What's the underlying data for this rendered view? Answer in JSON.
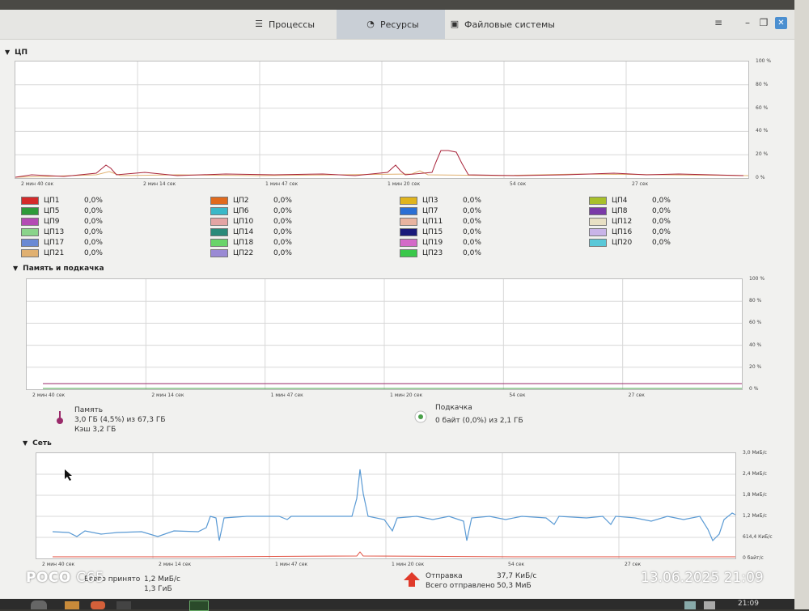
{
  "tabs": [
    {
      "label": "Процессы",
      "icon": "processes-icon"
    },
    {
      "label": "Ресурсы",
      "icon": "resources-icon"
    },
    {
      "label": "Файловые системы",
      "icon": "filesystems-icon"
    }
  ],
  "cpu": {
    "title": "ЦП",
    "y_labels": [
      "100 %",
      "80 %",
      "60 %",
      "40 %",
      "20 %",
      "0 %"
    ],
    "x_labels": [
      "2 мин 40 сек",
      "2 мин 14 сек",
      "1 мин 47 сек",
      "1 мин 20 сек",
      "54 сек",
      "27 сек"
    ],
    "cores": [
      {
        "name": "ЦП1",
        "value": "0,0%",
        "color": "#d42a2a"
      },
      {
        "name": "ЦП2",
        "value": "0,0%",
        "color": "#e06a1d"
      },
      {
        "name": "ЦП3",
        "value": "0,0%",
        "color": "#e0b41d"
      },
      {
        "name": "ЦП4",
        "value": "0,0%",
        "color": "#a8c02b"
      },
      {
        "name": "ЦП5",
        "value": "0,0%",
        "color": "#2e9a3a"
      },
      {
        "name": "ЦП6",
        "value": "0,0%",
        "color": "#3ab8c8"
      },
      {
        "name": "ЦП7",
        "value": "0,0%",
        "color": "#2a6fd4"
      },
      {
        "name": "ЦП8",
        "value": "0,0%",
        "color": "#7a3aa8"
      },
      {
        "name": "ЦП9",
        "value": "0,0%",
        "color": "#b44ab4"
      },
      {
        "name": "ЦП10",
        "value": "0,0%",
        "color": "#e4a4a4"
      },
      {
        "name": "ЦП11",
        "value": "0,0%",
        "color": "#e8b4a0"
      },
      {
        "name": "ЦП12",
        "value": "0,0%",
        "color": "#e8e0c4"
      },
      {
        "name": "ЦП13",
        "value": "0,0%",
        "color": "#8ad48a"
      },
      {
        "name": "ЦП14",
        "value": "0,0%",
        "color": "#2a8a7a"
      },
      {
        "name": "ЦП15",
        "value": "0,0%",
        "color": "#1a1a7a"
      },
      {
        "name": "ЦП16",
        "value": "0,0%",
        "color": "#c8b4e8"
      },
      {
        "name": "ЦП17",
        "value": "0,0%",
        "color": "#6a8ad4"
      },
      {
        "name": "ЦП18",
        "value": "0,0%",
        "color": "#6ad46a"
      },
      {
        "name": "ЦП19",
        "value": "0,0%",
        "color": "#d46ac8"
      },
      {
        "name": "ЦП20",
        "value": "0,0%",
        "color": "#5ac8d8"
      },
      {
        "name": "ЦП21",
        "value": "0,0%",
        "color": "#e0b070"
      },
      {
        "name": "ЦП22",
        "value": "0,0%",
        "color": "#9a8ad4"
      },
      {
        "name": "ЦП23",
        "value": "0,0%",
        "color": "#3ac84a"
      }
    ]
  },
  "memory": {
    "title": "Память и подкачка",
    "y_labels": [
      "100 %",
      "80 %",
      "60 %",
      "40 %",
      "20 %",
      "0 %"
    ],
    "x_labels": [
      "2 мин 40 сек",
      "2 мин 14 сек",
      "1 мин 47 сек",
      "1 мин 20 сек",
      "54 сек",
      "27 сек"
    ],
    "mem_label": "Память",
    "mem_used": "3,0 ГБ (4,5%) из 67,3 ГБ",
    "mem_cache": "Кэш 3,2 ГБ",
    "swap_label": "Подкачка",
    "swap_used": "0 байт (0,0%) из 2,1 ГБ",
    "mem_color": "#9a2a6a",
    "swap_color": "#4aa04a"
  },
  "network": {
    "title": "Сеть",
    "y_labels": [
      "3,0 МиБ/с",
      "2,4 МиБ/с",
      "1,8 МиБ/с",
      "1,2 МиБ/с",
      "614,4 КиБ/с",
      "0 байт/с"
    ],
    "x_labels": [
      "2 мин 40 сек",
      "2 мин 14 сек",
      "1 мин 47 сек",
      "1 мин 20 сек",
      "54 сек",
      "27 сек"
    ],
    "recv_label": "Всего принято",
    "recv_rate": "1,2 МиБ/с",
    "recv_total": "1,3 ГиБ",
    "send_label": "Отправка",
    "send_total_label": "Всего отправлено",
    "send_rate": "37,7 КиБ/с",
    "send_total": "50,3 МиБ",
    "recv_color": "#5a9ad4",
    "send_color": "#e04a3a"
  },
  "watermark": {
    "brand": "POCO",
    "model": "C65",
    "datetime": "13.06.2025  21:09"
  },
  "tray": {
    "clock": "21:09"
  }
}
